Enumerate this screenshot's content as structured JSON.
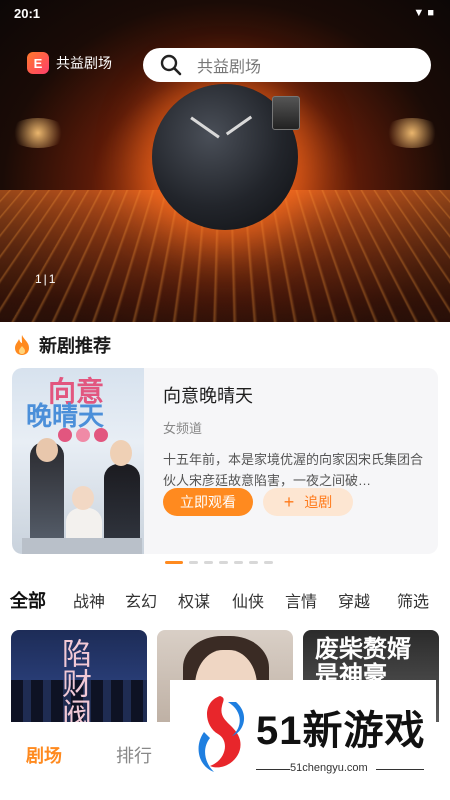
{
  "status_bar": {
    "time": "20:1",
    "icons": "▼ ■"
  },
  "header": {
    "logo_text": "共益剧场",
    "logo_badge": "E",
    "search_placeholder": "共益剧场"
  },
  "banner": {
    "counter": "1|1"
  },
  "recommend": {
    "section_title": "新剧推荐",
    "poster_title_line1": "向意",
    "poster_title_line2": "晚晴天",
    "title": "向意晚晴天",
    "channel": "女频道",
    "description": "十五年前，本是家境优渥的向家因宋氏集团合伙人宋彦廷故意陷害，一夜之间破…",
    "watch_button": "立即观看",
    "follow_button": "追剧"
  },
  "pagination": {
    "count": 7,
    "active": 0
  },
  "categories": [
    "全部",
    "战神",
    "玄幻",
    "权谋",
    "仙侠",
    "言情",
    "穿越",
    "筛选"
  ],
  "thumbnails": [
    {
      "title": "陷财阀"
    },
    {
      "title": ""
    },
    {
      "title": "废柴赘婿是神豪"
    }
  ],
  "bottom_nav": [
    "剧场",
    "排行"
  ],
  "watermark": {
    "brand": "51新游戏",
    "url": "51chengyu.com"
  },
  "colors": {
    "accent": "#ff8a1f",
    "accent_light": "#fde6d2"
  }
}
